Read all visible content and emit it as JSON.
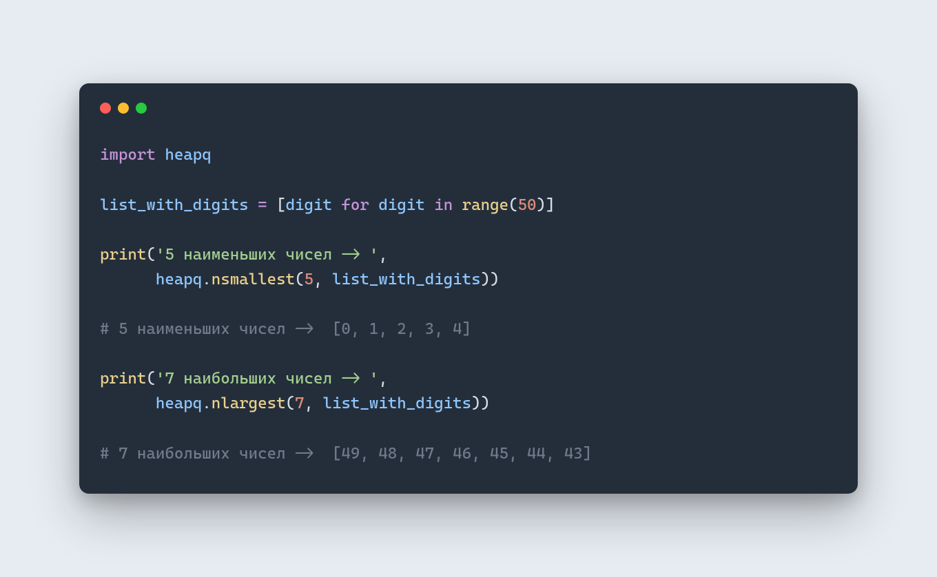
{
  "colors": {
    "background_page": "#e7ecf2",
    "background_window": "#242e3b",
    "dot_red": "#ff5f56",
    "dot_yellow": "#ffbd2e",
    "dot_green": "#27c93f",
    "keyword": "#c694d9",
    "identifier": "#8fc7ff",
    "function": "#e9d08b",
    "string": "#a3cf8f",
    "number": "#e08d7a",
    "comment": "#6f7b8a",
    "default": "#d7dde3"
  },
  "code": {
    "l1": {
      "import": "import",
      "sp1": " ",
      "heapq": "heapq"
    },
    "l2": "",
    "l3": {
      "var": "list_with_digits",
      "sp1": " ",
      "eq": "=",
      "sp2": " ",
      "lb": "[",
      "digit1": "digit",
      "sp3": " ",
      "for": "for",
      "sp4": " ",
      "digit2": "digit",
      "sp5": " ",
      "in": "in",
      "sp6": " ",
      "range": "range",
      "lp": "(",
      "n50": "50",
      "rp": ")",
      "rb": "]"
    },
    "l4": "",
    "l5": {
      "print": "print",
      "lp": "(",
      "str": "'5 наименьших чисел -> '",
      "comma": ","
    },
    "l6": {
      "indent": "      ",
      "heapq": "heapq",
      "dot": ".",
      "fn": "nsmallest",
      "lp": "(",
      "n5": "5",
      "comma": ",",
      "sp": " ",
      "var": "list_with_digits",
      "rp": ")",
      "rp2": ")"
    },
    "l7": "",
    "l8": {
      "comment": "# 5 наименьших чисел ->  [0, 1, 2, 3, 4]"
    },
    "l9": "",
    "l10": {
      "print": "print",
      "lp": "(",
      "str": "'7 наибольших чисел -> '",
      "comma": ","
    },
    "l11": {
      "indent": "      ",
      "heapq": "heapq",
      "dot": ".",
      "fn": "nlargest",
      "lp": "(",
      "n7": "7",
      "comma": ",",
      "sp": " ",
      "var": "list_with_digits",
      "rp": ")",
      "rp2": ")"
    },
    "l12": "",
    "l13": {
      "comment": "# 7 наибольших чисел ->  [49, 48, 47, 46, 45, 44, 43]"
    }
  }
}
